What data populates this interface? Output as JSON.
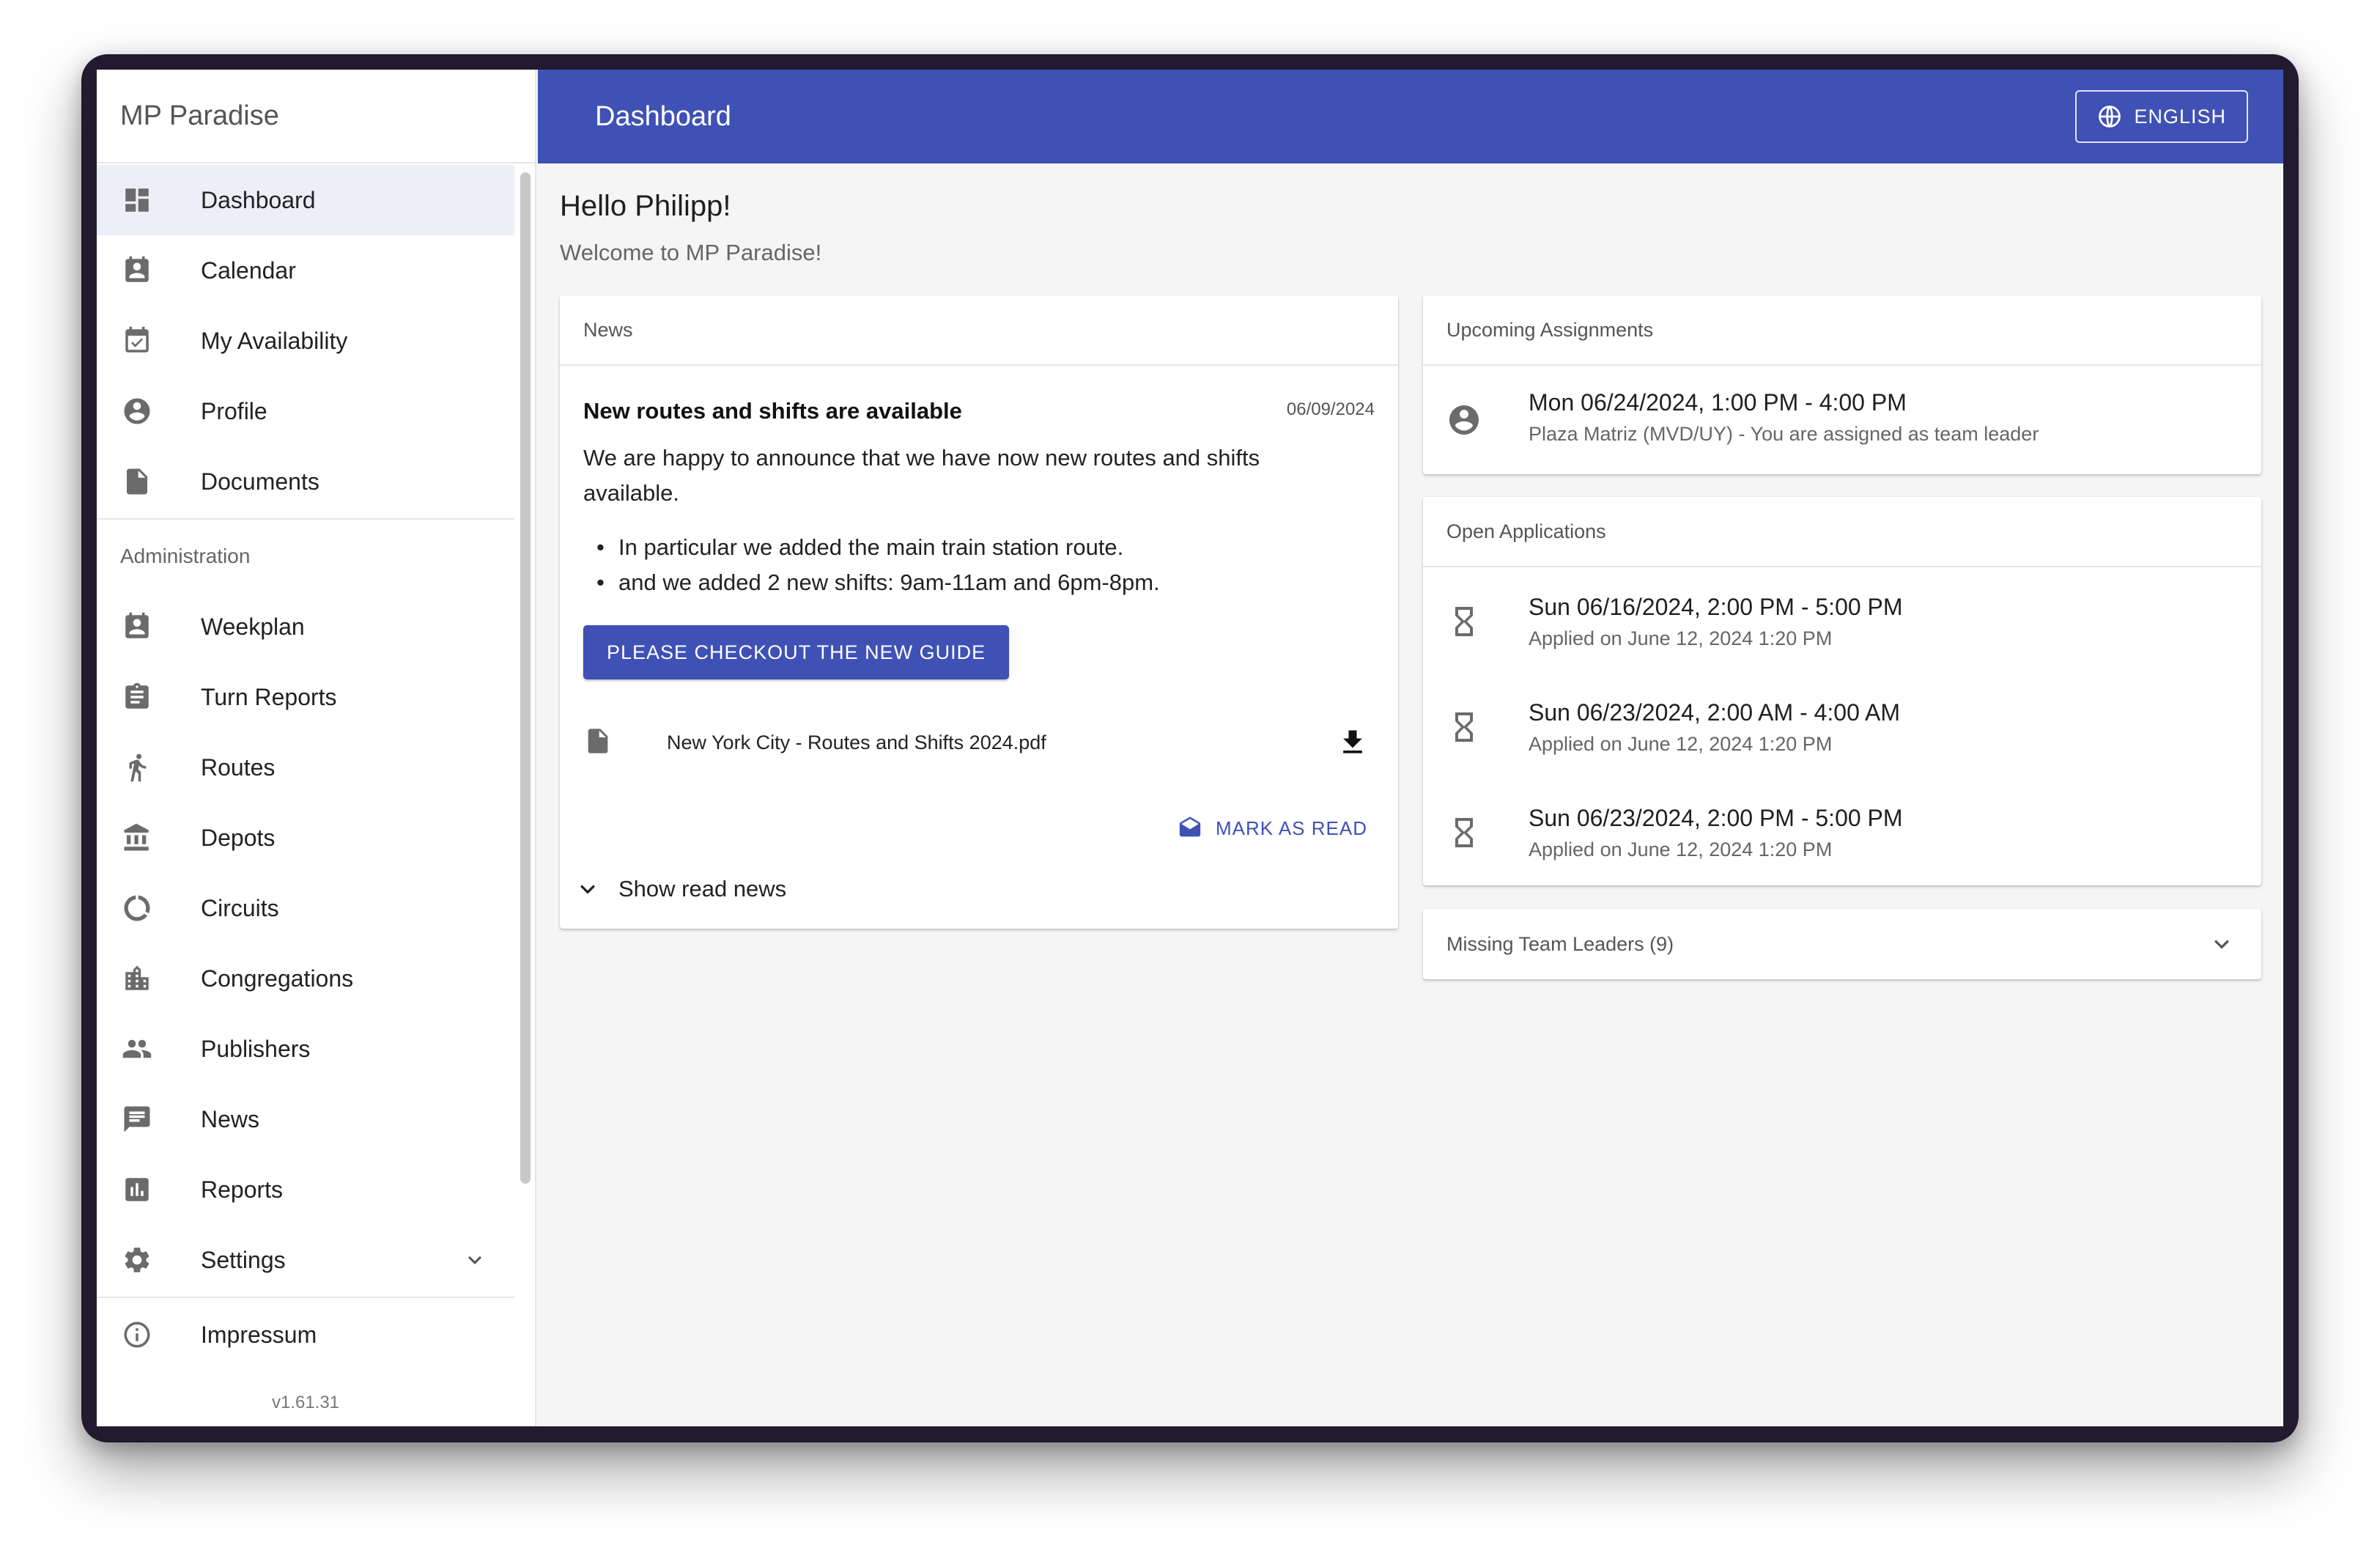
{
  "app": {
    "brand": "MP Paradise",
    "version": "v1.61.31"
  },
  "sidebar": {
    "items": [
      {
        "label": "Dashboard",
        "icon": "dashboard-icon",
        "active": true
      },
      {
        "label": "Calendar",
        "icon": "calendar-icon"
      },
      {
        "label": "My Availability",
        "icon": "availability-icon"
      },
      {
        "label": "Profile",
        "icon": "profile-icon"
      },
      {
        "label": "Documents",
        "icon": "document-icon"
      }
    ],
    "admin_header": "Administration",
    "admin_items": [
      {
        "label": "Weekplan",
        "icon": "weekplan-icon"
      },
      {
        "label": "Turn Reports",
        "icon": "clipboard-icon"
      },
      {
        "label": "Routes",
        "icon": "routes-icon"
      },
      {
        "label": "Depots",
        "icon": "depot-icon"
      },
      {
        "label": "Circuits",
        "icon": "circuit-icon"
      },
      {
        "label": "Congregations",
        "icon": "building-icon"
      },
      {
        "label": "Publishers",
        "icon": "people-icon"
      },
      {
        "label": "News",
        "icon": "news-icon"
      },
      {
        "label": "Reports",
        "icon": "reports-icon"
      },
      {
        "label": "Settings",
        "icon": "gear-icon"
      }
    ],
    "footer_item": {
      "label": "Impressum",
      "icon": "info-icon"
    }
  },
  "header": {
    "title": "Dashboard",
    "language": "ENGLISH"
  },
  "main": {
    "greeting": "Hello Philipp!",
    "welcome": "Welcome to MP Paradise!",
    "news": {
      "header": "News",
      "title": "New routes and shifts are available",
      "date": "06/09/2024",
      "body": "We are happy to announce that we have now new routes and shifts available.",
      "bullets": [
        "In particular we added the main train station route.",
        "and we added 2 new shifts: 9am-11am and 6pm-8pm."
      ],
      "button": "PLEASE CHECKOUT THE NEW GUIDE",
      "attachment": "New York City - Routes and Shifts 2024.pdf",
      "mark_read": "MARK AS READ",
      "show_read": "Show read news"
    },
    "upcoming": {
      "header": "Upcoming Assignments",
      "items": [
        {
          "title": "Mon 06/24/2024, 1:00 PM - 4:00 PM",
          "subtitle": "Plaza Matriz (MVD/UY) - You are assigned as team leader"
        }
      ]
    },
    "open_applications": {
      "header": "Open Applications",
      "items": [
        {
          "title": "Sun 06/16/2024, 2:00 PM - 5:00 PM",
          "subtitle": "Applied on June 12, 2024 1:20 PM"
        },
        {
          "title": "Sun 06/23/2024, 2:00 AM - 4:00 AM",
          "subtitle": "Applied on June 12, 2024 1:20 PM"
        },
        {
          "title": "Sun 06/23/2024, 2:00 PM - 5:00 PM",
          "subtitle": "Applied on June 12, 2024 1:20 PM"
        }
      ]
    },
    "missing_team_leaders": {
      "header": "Missing Team Leaders (9)"
    }
  },
  "colors": {
    "primary": "#3f51b5",
    "active_bg": "#eceef8",
    "background": "#f5f5f5"
  }
}
